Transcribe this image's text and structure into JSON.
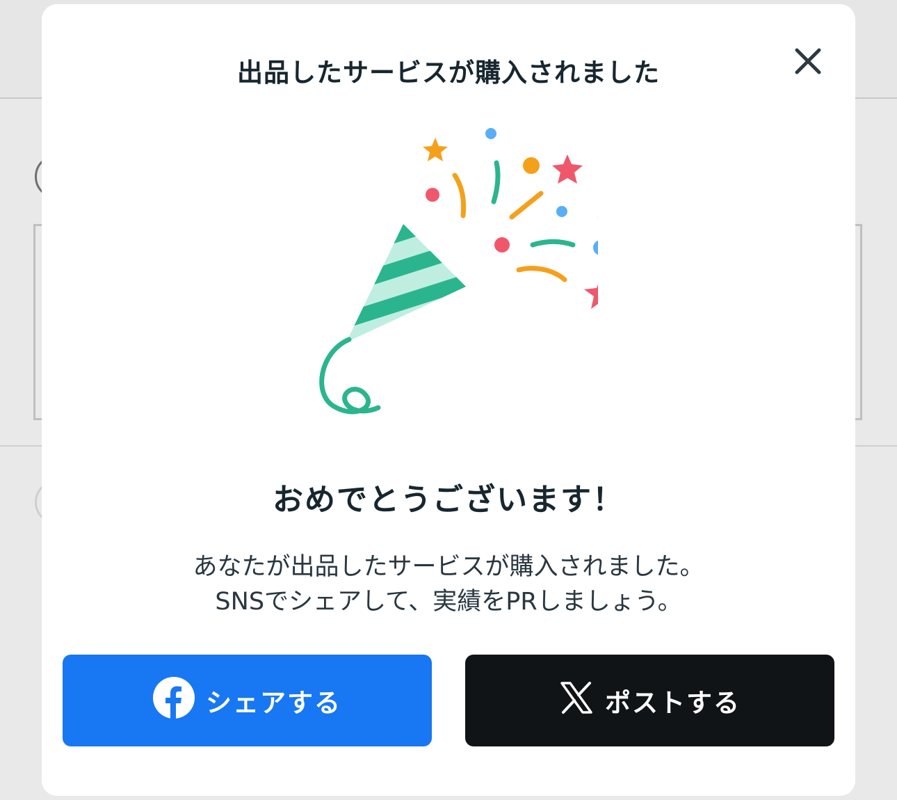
{
  "dialog": {
    "title": "出品したサービスが購入されました",
    "close_icon": "close-icon",
    "illustration": "party-popper-illustration",
    "congrats": "おめでとうございます！",
    "message_line1": "あなたが出品したサービスが購入されました。",
    "message_line2": "SNSでシェアして、実績をPRしましょう。",
    "buttons": {
      "facebook": {
        "label": "シェアする",
        "icon": "facebook-icon",
        "color": "#1877f2"
      },
      "x": {
        "label": "ポストする",
        "icon": "x-logo-icon",
        "color": "#111417"
      }
    }
  },
  "colors": {
    "overlay": "#e9e9e9",
    "title_text": "#17262f",
    "popper_green": "#2bb58f",
    "confetti_orange": "#f5a01a",
    "confetti_pink": "#f0576b",
    "confetti_blue": "#5aaef5"
  }
}
